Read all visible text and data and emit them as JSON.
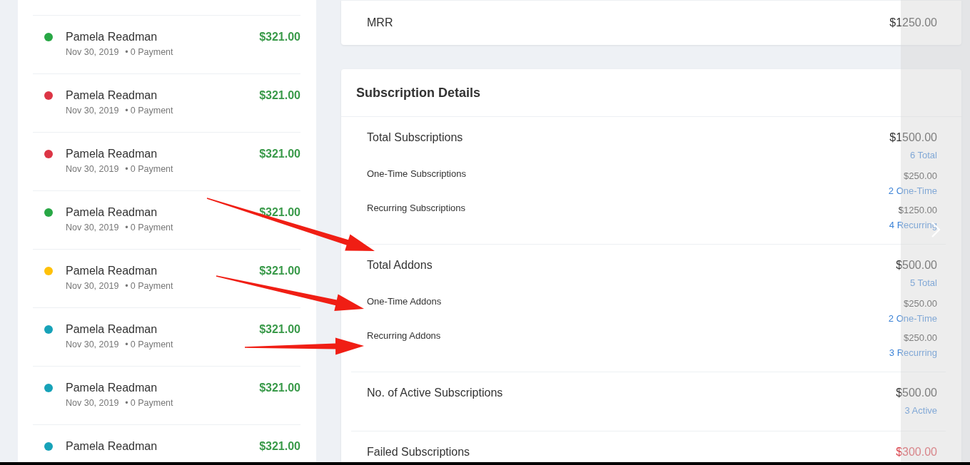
{
  "transactions": [
    {
      "name": "Pamela Readman",
      "date": "Nov 30, 2019",
      "bullet": "•",
      "payments": "0 Payment",
      "amount": "$321.00",
      "color": "#28a745"
    },
    {
      "name": "Pamela Readman",
      "date": "Nov 30, 2019",
      "bullet": "•",
      "payments": "0 Payment",
      "amount": "$321.00",
      "color": "#dc3545"
    },
    {
      "name": "Pamela Readman",
      "date": "Nov 30, 2019",
      "bullet": "•",
      "payments": "0 Payment",
      "amount": "$321.00",
      "color": "#dc3545"
    },
    {
      "name": "Pamela Readman",
      "date": "Nov 30, 2019",
      "bullet": "•",
      "payments": "0 Payment",
      "amount": "$321.00",
      "color": "#28a745"
    },
    {
      "name": "Pamela Readman",
      "date": "Nov 30, 2019",
      "bullet": "•",
      "payments": "0 Payment",
      "amount": "$321.00",
      "color": "#ffc107"
    },
    {
      "name": "Pamela Readman",
      "date": "Nov 30, 2019",
      "bullet": "•",
      "payments": "0 Payment",
      "amount": "$321.00",
      "color": "#17a2b8"
    },
    {
      "name": "Pamela Readman",
      "date": "Nov 30, 2019",
      "bullet": "•",
      "payments": "0 Payment",
      "amount": "$321.00",
      "color": "#17a2b8"
    },
    {
      "name": "Pamela Readman",
      "amount": "$321.00",
      "color": "#17a2b8"
    }
  ],
  "mrr": {
    "label": "MRR",
    "value": "$1250.00"
  },
  "subscription_details": {
    "title": "Subscription Details",
    "sections": [
      {
        "lines": [
          {
            "kind": "main",
            "label": "Total Subscriptions",
            "value": "$1500.00",
            "sub": "6 Total"
          },
          {
            "kind": "sub",
            "label": "One-Time Subscriptions",
            "value": "$250.00",
            "sub": "2 One-Time"
          },
          {
            "kind": "sub",
            "label": "Recurring Subscriptions",
            "value": "$1250.00",
            "sub": "4 Recurring"
          }
        ]
      },
      {
        "lines": [
          {
            "kind": "main",
            "label": "Total Addons",
            "value": "$500.00",
            "sub": "5 Total"
          },
          {
            "kind": "sub",
            "label": "One-Time Addons",
            "value": "$250.00",
            "sub": "2 One-Time"
          },
          {
            "kind": "sub",
            "label": "Recurring Addons",
            "value": "$250.00",
            "sub": "3 Recurring"
          }
        ]
      },
      {
        "lines": [
          {
            "kind": "main",
            "label": "No. of Active Subscriptions",
            "value": "$500.00",
            "sub": "3 Active"
          }
        ]
      },
      {
        "lines": [
          {
            "kind": "failed",
            "label": "Failed Subscriptions",
            "value": "$300.00"
          }
        ]
      }
    ]
  },
  "annotation_arrows": [
    {
      "color": "#f01e14"
    },
    {
      "color": "#f01e14"
    },
    {
      "color": "#f01e14"
    }
  ],
  "viewer": {
    "next_arrow": true
  }
}
